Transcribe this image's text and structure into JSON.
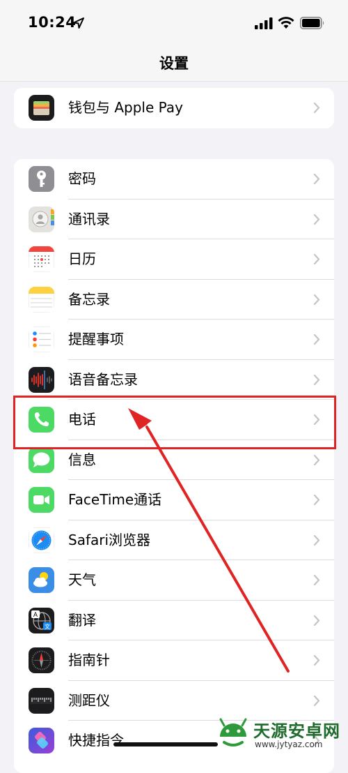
{
  "status_bar": {
    "time": "10:24"
  },
  "nav": {
    "title": "设置"
  },
  "group_top": [
    {
      "label": "钱包与 Apple Pay",
      "icon": "wallet-icon"
    }
  ],
  "group_apps": [
    {
      "label": "密码",
      "icon": "key-icon"
    },
    {
      "label": "通讯录",
      "icon": "contacts-icon"
    },
    {
      "label": "日历",
      "icon": "calendar-icon"
    },
    {
      "label": "备忘录",
      "icon": "notes-icon"
    },
    {
      "label": "提醒事项",
      "icon": "reminders-icon"
    },
    {
      "label": "语音备忘录",
      "icon": "voice-memos-icon"
    },
    {
      "label": "电话",
      "icon": "phone-icon"
    },
    {
      "label": "信息",
      "icon": "messages-icon"
    },
    {
      "label": "FaceTime通话",
      "icon": "facetime-icon"
    },
    {
      "label": "Safari浏览器",
      "icon": "safari-icon"
    },
    {
      "label": "天气",
      "icon": "weather-icon"
    },
    {
      "label": "翻译",
      "icon": "translate-icon"
    },
    {
      "label": "指南针",
      "icon": "compass-icon"
    },
    {
      "label": "测距仪",
      "icon": "measure-icon"
    },
    {
      "label": "快捷指令",
      "icon": "shortcuts-icon"
    }
  ],
  "annotation": {
    "highlighted_item": "电话",
    "color": "#e02424"
  },
  "watermark": {
    "title": "天源安卓网",
    "url": "www.jytyaz.com"
  }
}
